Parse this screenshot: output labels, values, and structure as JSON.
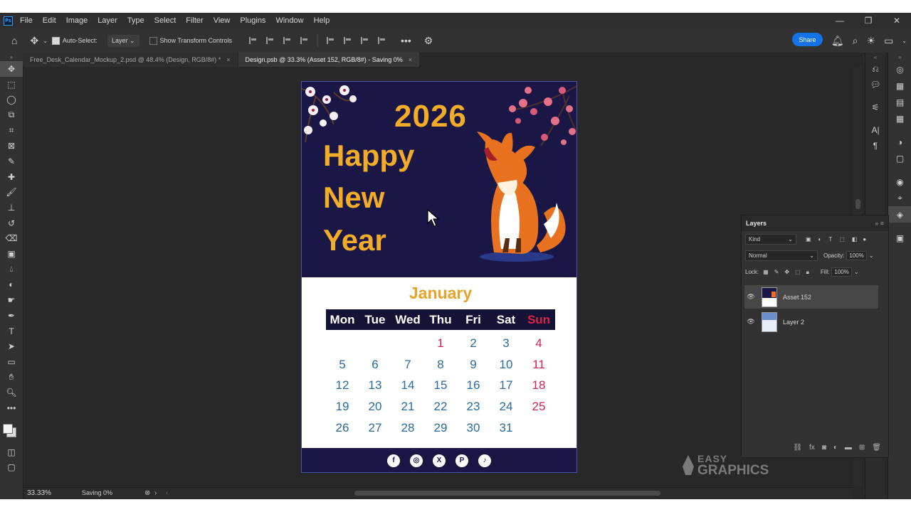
{
  "app": {
    "menu": [
      "File",
      "Edit",
      "Image",
      "Layer",
      "Type",
      "Select",
      "Filter",
      "View",
      "Plugins",
      "Window",
      "Help"
    ],
    "window_controls": [
      "—",
      "❐",
      "✕"
    ]
  },
  "options_bar": {
    "auto_select_label": "Auto-Select:",
    "auto_select_value": "Layer",
    "transform_label": "Show Transform Controls",
    "share_label": "Share"
  },
  "tabs": [
    {
      "label": "Free_Desk_Calendar_Mockup_2.psd @ 48.4% (Design, RGB/8#) *",
      "close": "×"
    },
    {
      "label": "Design.psb @ 33.3% (Asset 152, RGB/8#) - Saving 0%",
      "close": "×"
    }
  ],
  "status": {
    "zoom": "33.33%",
    "saving": "Saving 0%"
  },
  "design": {
    "year": "2026",
    "greeting": [
      "Happy",
      "New",
      "Year"
    ],
    "month": "January",
    "weekdays": [
      "Mon",
      "Tue",
      "Wed",
      "Thu",
      "Fri",
      "Sat",
      "Sun"
    ],
    "weeks": [
      [
        "",
        "",
        "",
        "1",
        "2",
        "3",
        "4"
      ],
      [
        "5",
        "6",
        "7",
        "8",
        "9",
        "10",
        "11"
      ],
      [
        "12",
        "13",
        "14",
        "15",
        "16",
        "17",
        "18"
      ],
      [
        "19",
        "20",
        "21",
        "22",
        "23",
        "24",
        "25"
      ],
      [
        "26",
        "27",
        "28",
        "29",
        "30",
        "31",
        ""
      ]
    ],
    "social": [
      "f",
      "◎",
      "X",
      "P",
      "♪"
    ],
    "colors": {
      "navy": "#1a1646",
      "gold": "#f2ad28",
      "sunday": "#cc2456",
      "date": "#2a6aa1"
    }
  },
  "layers_panel": {
    "title": "Layers",
    "kind_label": "Kind",
    "blend_mode": "Normal",
    "opacity_label": "Opacity:",
    "opacity_value": "100%",
    "lock_label": "Lock:",
    "fill_label": "Fill:",
    "fill_value": "100%",
    "layers": [
      {
        "name": "Asset 152",
        "selected": true
      },
      {
        "name": "Layer 2",
        "selected": false
      }
    ]
  },
  "watermark": {
    "line1": "EASY",
    "line2": "GRAPHICS"
  }
}
